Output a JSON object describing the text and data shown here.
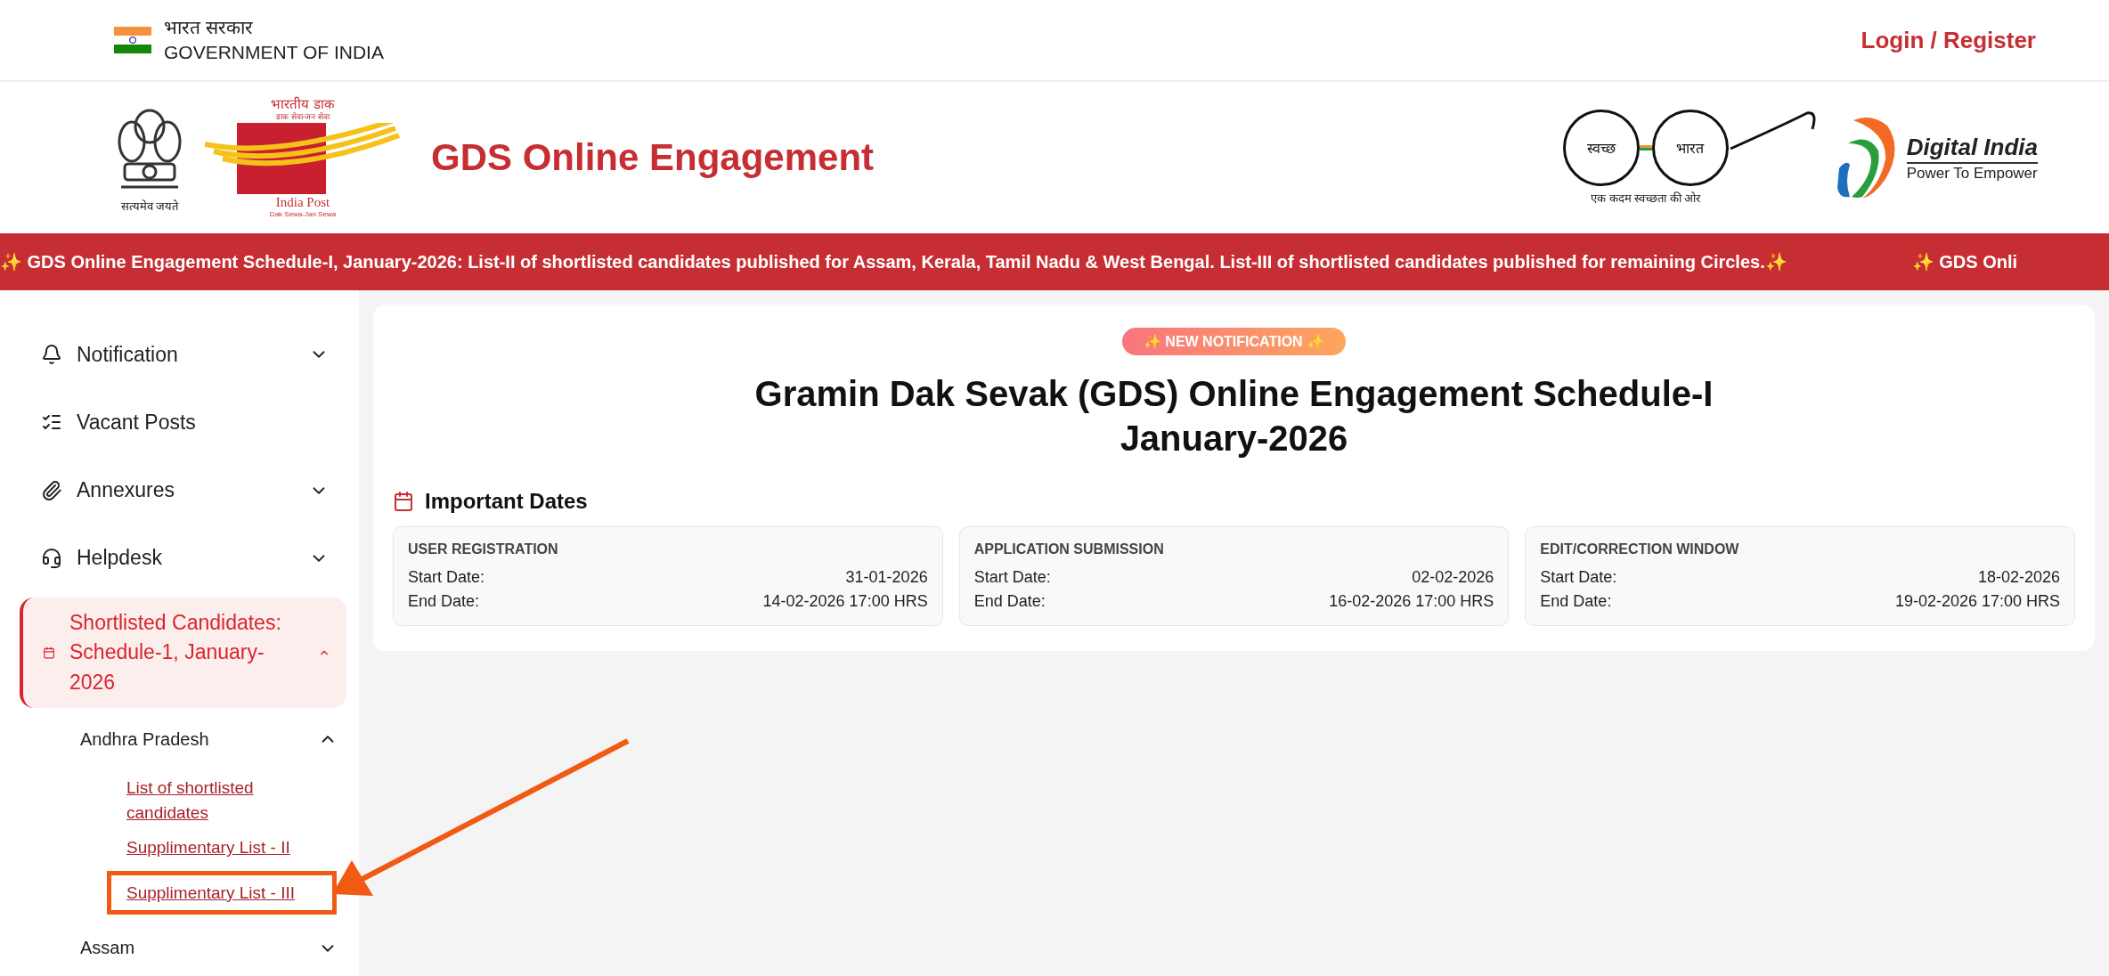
{
  "top_bar": {
    "hindi_label": "भारत सरकार",
    "label": "GOVERNMENT OF INDIA",
    "login_link": "Login / Register"
  },
  "header": {
    "emblem_motto": "सत्यमेव जयते",
    "post_logo": {
      "hindi": "भारतीय डाक",
      "hindi_motto": "डाक सेवा-जन सेवा",
      "name": "India Post",
      "motto": "Dak Sewa-Jan Sewa"
    },
    "site_title": "GDS Online Engagement",
    "swachh_logo": {
      "left": "स्वच्छ",
      "right": "भारत",
      "caption": "एक कदम स्वच्छता की ओर"
    },
    "digital_india": {
      "name": "Digital India",
      "tagline": "Power To Empower"
    }
  },
  "ticker": [
    "✨ GDS Online Engagement Schedule-I, January-2026: List-II of shortlisted candidates published for Assam, Kerala, Tamil Nadu & West Bengal. List-III of shortlisted candidates published for remaining Circles.✨",
    "✨ GDS Onli"
  ],
  "sidebar": {
    "items": [
      {
        "label": "Notification",
        "expanded": false,
        "selected": false
      },
      {
        "label": "Vacant Posts",
        "selected": false
      },
      {
        "label": "Annexures",
        "expanded": false,
        "selected": false
      },
      {
        "label": "Helpdesk",
        "expanded": false,
        "selected": false
      },
      {
        "label": "Shortlisted Candidates: Schedule-1, January-2026",
        "expanded": true,
        "selected": true,
        "children": [
          {
            "label": "Andhra Pradesh",
            "expanded": true,
            "children": [
              {
                "label": "List of shortlisted candidates",
                "highlighted": false
              },
              {
                "label": "Supplimentary List - II",
                "highlighted": false
              },
              {
                "label": "Supplimentary List - III",
                "highlighted": true
              }
            ]
          },
          {
            "label": "Assam",
            "expanded": false
          }
        ]
      }
    ]
  },
  "main": {
    "badge": "✨ NEW NOTIFICATION ✨",
    "title_lines": [
      "Gramin Dak Sevak (GDS) Online Engagement Schedule-I",
      "January-2026"
    ],
    "section_heading": "Important Dates",
    "date_cards": [
      {
        "title": "USER REGISTRATION",
        "rows": [
          {
            "label": "Start Date:",
            "value": "31-01-2026"
          },
          {
            "label": "End Date:",
            "value": "14-02-2026 17:00 HRS"
          }
        ]
      },
      {
        "title": "APPLICATION SUBMISSION",
        "rows": [
          {
            "label": "Start Date:",
            "value": "02-02-2026"
          },
          {
            "label": "End Date:",
            "value": "16-02-2026 17:00 HRS"
          }
        ]
      },
      {
        "title": "EDIT/CORRECTION WINDOW",
        "rows": [
          {
            "label": "Start Date:",
            "value": "18-02-2026"
          },
          {
            "label": "End Date:",
            "value": "19-02-2026 17:00 HRS"
          }
        ]
      }
    ]
  }
}
